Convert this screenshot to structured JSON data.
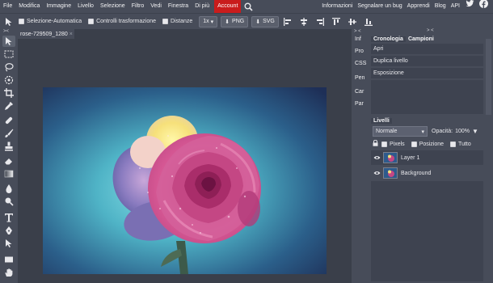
{
  "menubar": {
    "items": [
      "File",
      "Modifica",
      "Immagine",
      "Livello",
      "Selezione",
      "Filtro",
      "Vedi",
      "Finestra",
      "Di più"
    ],
    "account": "Account",
    "right": [
      "Informazioni",
      "Segnalare un bug",
      "Apprendi",
      "Blog",
      "API"
    ]
  },
  "options": {
    "auto_select": "Selezione-Automatica",
    "transform_controls": "Controlli trasformazione",
    "distances": "Distanze",
    "zoom": "1x",
    "png": "PNG",
    "svg": "SVG"
  },
  "document": {
    "tab_name": "rose-729509_1280",
    "close": "×"
  },
  "collapser": {
    "arrows": "> <",
    "tabs": [
      "Inf",
      "Pro",
      "CSS",
      "Pen",
      "Car",
      "Par"
    ]
  },
  "history": {
    "tabs": [
      "Cronologia",
      "Campioni"
    ],
    "arrows": "> <",
    "items": [
      "Apri",
      "Duplica livello",
      "Esposizione"
    ]
  },
  "layers": {
    "title": "Livelli",
    "blend_mode": "Normale",
    "opacity_label": "Opacità:",
    "opacity_value": "100%",
    "lock_pixels": "Pixels",
    "lock_position": "Posizione",
    "lock_all": "Tutto",
    "items": [
      {
        "name": "Layer 1",
        "selected": true
      },
      {
        "name": "Background",
        "selected": false
      }
    ]
  },
  "colors": {
    "bg": "#3a3f4a",
    "panel": "#474c59",
    "account": "#c91c1c"
  }
}
